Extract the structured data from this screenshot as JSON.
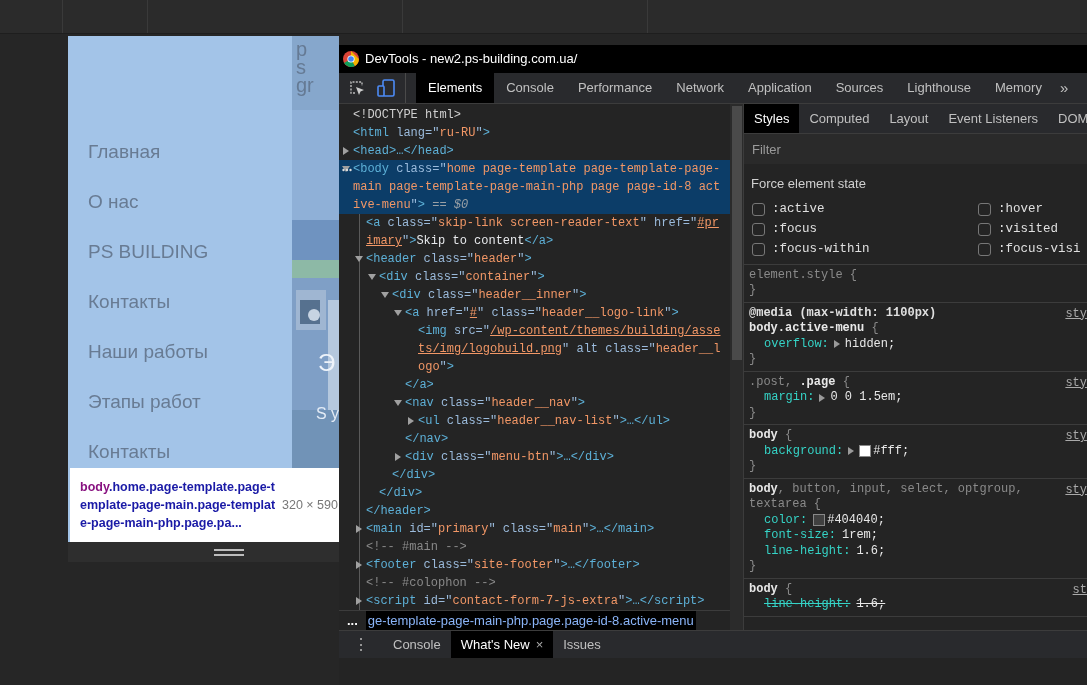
{
  "preview": {
    "logo_letters": [
      "p",
      "s",
      "gr"
    ],
    "menu": [
      {
        "label": "Главная"
      },
      {
        "label": "О нас"
      },
      {
        "label": "PS BUILDING"
      },
      {
        "label": "Контакты"
      },
      {
        "label": "Наши работы"
      },
      {
        "label": "Этапы работ"
      },
      {
        "label": "Контакты"
      }
    ],
    "hero_fragments": [
      "Э",
      "S y"
    ],
    "tooltip": {
      "tag": "body",
      "classes": ".home.page-template.page-template-page-main.page-template-page-main-php.page.pa...",
      "size": "320 × 590"
    }
  },
  "devtools": {
    "title": "DevTools - new2.ps-building.com.ua/",
    "tabs": [
      {
        "label": "Elements",
        "selected": true
      },
      {
        "label": "Console",
        "selected": false
      },
      {
        "label": "Performance",
        "selected": false
      },
      {
        "label": "Network",
        "selected": false
      },
      {
        "label": "Application",
        "selected": false
      },
      {
        "label": "Sources",
        "selected": false
      },
      {
        "label": "Lighthouse",
        "selected": false
      },
      {
        "label": "Memory",
        "selected": false
      }
    ],
    "more_tabs": "»",
    "dom": [
      {
        "selected": false,
        "tokens": [
          {
            "kind": "doctype",
            "text": "<!DOCTYPE html>"
          }
        ]
      },
      {
        "selected": false,
        "tokens": [
          {
            "kind": "tag",
            "text": "<html"
          },
          {
            "kind": "attr",
            "text": " lang=\""
          },
          {
            "kind": "value",
            "text": "ru-RU"
          },
          {
            "kind": "attr",
            "text": "\""
          },
          {
            "kind": "tag",
            "text": ">"
          }
        ],
        "children": [
          {
            "selected": false,
            "expanded": false,
            "tokens": [
              {
                "kind": "tag",
                "text": "<head>…</head>"
              }
            ]
          },
          {
            "selected": true,
            "expanded": true,
            "tokens": [
              {
                "kind": "tag",
                "text": "<body"
              },
              {
                "kind": "attr",
                "text": " class=\""
              },
              {
                "kind": "value",
                "text": "home page-template page-template-page-main page-template-page-main-php page page-id-8 active-menu"
              },
              {
                "kind": "attr",
                "text": "\""
              },
              {
                "kind": "tag",
                "text": ">"
              },
              {
                "kind": "marker",
                "text": " == $0"
              }
            ],
            "children": [
              {
                "selected": false,
                "tokens": [
                  {
                    "kind": "tag",
                    "text": "<a"
                  },
                  {
                    "kind": "attr",
                    "text": " class=\""
                  },
                  {
                    "kind": "value",
                    "text": "skip-link screen-reader-text"
                  },
                  {
                    "kind": "attr",
                    "text": "\" href=\""
                  },
                  {
                    "kind": "link",
                    "text": "#primary"
                  },
                  {
                    "kind": "attr",
                    "text": "\""
                  },
                  {
                    "kind": "tag",
                    "text": ">"
                  },
                  {
                    "kind": "text",
                    "text": "Skip to content"
                  },
                  {
                    "kind": "tag",
                    "text": "</a>"
                  }
                ]
              },
              {
                "selected": false,
                "expanded": true,
                "tokens": [
                  {
                    "kind": "tag",
                    "text": "<header"
                  },
                  {
                    "kind": "attr",
                    "text": " class=\""
                  },
                  {
                    "kind": "value",
                    "text": "header"
                  },
                  {
                    "kind": "attr",
                    "text": "\""
                  },
                  {
                    "kind": "tag",
                    "text": ">"
                  }
                ],
                "close": "</header>",
                "children": [
                  {
                    "selected": false,
                    "expanded": true,
                    "tokens": [
                      {
                        "kind": "tag",
                        "text": "<div"
                      },
                      {
                        "kind": "attr",
                        "text": " class=\""
                      },
                      {
                        "kind": "value",
                        "text": "container"
                      },
                      {
                        "kind": "attr",
                        "text": "\""
                      },
                      {
                        "kind": "tag",
                        "text": ">"
                      }
                    ],
                    "close": "</div>",
                    "children": [
                      {
                        "selected": false,
                        "expanded": true,
                        "tokens": [
                          {
                            "kind": "tag",
                            "text": "<div"
                          },
                          {
                            "kind": "attr",
                            "text": " class=\""
                          },
                          {
                            "kind": "value",
                            "text": "header__inner"
                          },
                          {
                            "kind": "attr",
                            "text": "\""
                          },
                          {
                            "kind": "tag",
                            "text": ">"
                          }
                        ],
                        "close": "</div>",
                        "children": [
                          {
                            "selected": false,
                            "expanded": true,
                            "tokens": [
                              {
                                "kind": "tag",
                                "text": "<a"
                              },
                              {
                                "kind": "attr",
                                "text": " href=\""
                              },
                              {
                                "kind": "link",
                                "text": "#"
                              },
                              {
                                "kind": "attr",
                                "text": "\" class=\""
                              },
                              {
                                "kind": "value",
                                "text": "header__logo-link"
                              },
                              {
                                "kind": "attr",
                                "text": "\""
                              },
                              {
                                "kind": "tag",
                                "text": ">"
                              }
                            ],
                            "close": "</a>",
                            "children": [
                              {
                                "selected": false,
                                "tokens": [
                                  {
                                    "kind": "tag",
                                    "text": "<img"
                                  },
                                  {
                                    "kind": "attr",
                                    "text": " src=\""
                                  },
                                  {
                                    "kind": "link",
                                    "text": "/wp-content/themes/building/assets/img/logobuild.png"
                                  },
                                  {
                                    "kind": "attr",
                                    "text": "\" alt class=\""
                                  },
                                  {
                                    "kind": "value",
                                    "text": "header__logo"
                                  },
                                  {
                                    "kind": "attr",
                                    "text": "\""
                                  },
                                  {
                                    "kind": "tag",
                                    "text": ">"
                                  }
                                ]
                              }
                            ]
                          },
                          {
                            "selected": false,
                            "expanded": true,
                            "tokens": [
                              {
                                "kind": "tag",
                                "text": "<nav"
                              },
                              {
                                "kind": "attr",
                                "text": " class=\""
                              },
                              {
                                "kind": "value",
                                "text": "header__nav"
                              },
                              {
                                "kind": "attr",
                                "text": "\""
                              },
                              {
                                "kind": "tag",
                                "text": ">"
                              }
                            ],
                            "close": "</nav>",
                            "children": [
                              {
                                "selected": false,
                                "expanded": false,
                                "tokens": [
                                  {
                                    "kind": "tag",
                                    "text": "<ul"
                                  },
                                  {
                                    "kind": "attr",
                                    "text": " class=\""
                                  },
                                  {
                                    "kind": "value",
                                    "text": "header__nav-list"
                                  },
                                  {
                                    "kind": "attr",
                                    "text": "\""
                                  },
                                  {
                                    "kind": "tag",
                                    "text": ">…</ul>"
                                  }
                                ]
                              }
                            ]
                          },
                          {
                            "selected": false,
                            "expanded": false,
                            "tokens": [
                              {
                                "kind": "tag",
                                "text": "<div"
                              },
                              {
                                "kind": "attr",
                                "text": " class=\""
                              },
                              {
                                "kind": "value",
                                "text": "menu-btn"
                              },
                              {
                                "kind": "attr",
                                "text": "\""
                              },
                              {
                                "kind": "tag",
                                "text": ">…</div>"
                              }
                            ]
                          }
                        ]
                      }
                    ]
                  }
                ]
              },
              {
                "selected": false,
                "expanded": false,
                "tokens": [
                  {
                    "kind": "tag",
                    "text": "<main"
                  },
                  {
                    "kind": "attr",
                    "text": " id=\""
                  },
                  {
                    "kind": "value",
                    "text": "primary"
                  },
                  {
                    "kind": "attr",
                    "text": "\" class=\""
                  },
                  {
                    "kind": "value",
                    "text": "main"
                  },
                  {
                    "kind": "attr",
                    "text": "\""
                  },
                  {
                    "kind": "tag",
                    "text": ">…</main>"
                  }
                ]
              },
              {
                "selected": false,
                "tokens": [
                  {
                    "kind": "comment",
                    "text": "<!-- #main -->"
                  }
                ]
              },
              {
                "selected": false,
                "expanded": false,
                "tokens": [
                  {
                    "kind": "tag",
                    "text": "<footer"
                  },
                  {
                    "kind": "attr",
                    "text": " class=\""
                  },
                  {
                    "kind": "value",
                    "text": "site-footer"
                  },
                  {
                    "kind": "attr",
                    "text": "\""
                  },
                  {
                    "kind": "tag",
                    "text": ">…</footer>"
                  }
                ]
              },
              {
                "selected": false,
                "tokens": [
                  {
                    "kind": "comment",
                    "text": "<!-- #colophon -->"
                  }
                ]
              },
              {
                "selected": false,
                "expanded": false,
                "tokens": [
                  {
                    "kind": "tag",
                    "text": "<script"
                  },
                  {
                    "kind": "attr",
                    "text": " id=\""
                  },
                  {
                    "kind": "value",
                    "text": "contact-form-7-js-extra"
                  },
                  {
                    "kind": "attr",
                    "text": "\""
                  },
                  {
                    "kind": "tag",
                    "text": ">…</script>"
                  }
                ]
              }
            ]
          }
        ]
      }
    ],
    "breadcrumb": {
      "more": "...",
      "item": "ge-template-page-main-php.page.page-id-8.active-menu"
    },
    "styles": {
      "tabs": [
        {
          "label": "Styles",
          "selected": true
        },
        {
          "label": "Computed",
          "selected": false
        },
        {
          "label": "Layout",
          "selected": false
        },
        {
          "label": "Event Listeners",
          "selected": false
        },
        {
          "label": "DOM",
          "selected": false
        }
      ],
      "filter": {
        "placeholder": "Filter"
      },
      "force_state": {
        "title": "Force element state",
        "states": [
          {
            "label": ":active",
            "checked": false
          },
          {
            "label": ":hover",
            "checked": false
          },
          {
            "label": ":focus",
            "checked": false
          },
          {
            "label": ":visited",
            "checked": false
          },
          {
            "label": ":focus-within",
            "checked": false
          },
          {
            "label": ":focus-visi",
            "checked": false
          }
        ]
      },
      "rules": [
        {
          "selector": [
            {
              "text": "element.style",
              "matched": false
            }
          ],
          "open": " {",
          "close": "}"
        },
        {
          "media": "@media (max-width: 1100px)",
          "selector": [
            {
              "text": "body.active-menu",
              "matched": true
            }
          ],
          "open": " {",
          "close": "}",
          "source": "sty",
          "properties": [
            {
              "name": "overflow:",
              "value": "hidden;",
              "expandable": true,
              "swatch": false,
              "overridden": false
            }
          ]
        },
        {
          "selector": [
            {
              "text": ".post, ",
              "matched": false
            },
            {
              "text": ".page",
              "matched": true
            }
          ],
          "open": " {",
          "close": "}",
          "source": "sty",
          "properties": [
            {
              "name": "margin:",
              "value": "0 0 1.5em;",
              "expandable": true,
              "swatch": false,
              "overridden": false
            }
          ]
        },
        {
          "selector": [
            {
              "text": "body",
              "matched": true
            }
          ],
          "open": " {",
          "close": "}",
          "source": "sty",
          "properties": [
            {
              "name": "background:",
              "value": "#fff;",
              "expandable": true,
              "swatch": true,
              "overridden": false
            }
          ]
        },
        {
          "selector": [
            {
              "text": "body",
              "matched": true
            },
            {
              "text": ", button, input, select, optgroup, textarea",
              "matched": false
            }
          ],
          "open": " {",
          "close": "}",
          "source": "sty",
          "properties": [
            {
              "name": "color:",
              "value": "#404040;",
              "expandable": false,
              "swatch": true,
              "overridden": false
            },
            {
              "name": "font-size:",
              "value": "1rem;",
              "expandable": false,
              "swatch": false,
              "overridden": false
            },
            {
              "name": "line-height:",
              "value": "1.6;",
              "expandable": false,
              "swatch": false,
              "overridden": false
            }
          ]
        },
        {
          "selector": [
            {
              "text": "body",
              "matched": true
            }
          ],
          "open": " {",
          "source": "st",
          "properties": [
            {
              "name": "line-height:",
              "value": "1.6;",
              "expandable": false,
              "swatch": false,
              "overridden": true
            }
          ]
        }
      ]
    },
    "drawer": {
      "menu": "⋮",
      "tabs": [
        {
          "label": "Console",
          "selected": false,
          "closable": false
        },
        {
          "label": "What's New",
          "selected": true,
          "closable": true
        },
        {
          "label": "Issues",
          "selected": false,
          "closable": false
        }
      ],
      "close": "×"
    }
  }
}
